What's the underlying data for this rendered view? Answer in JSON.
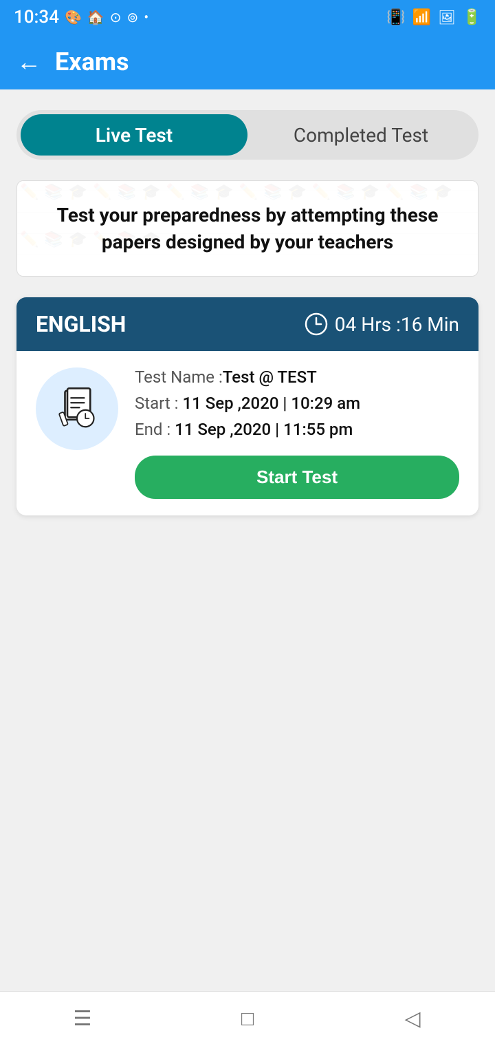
{
  "statusBar": {
    "time": "10:34",
    "icons": [
      "🎨",
      "🏠",
      "⊙",
      "⊚",
      "•"
    ]
  },
  "topBar": {
    "title": "Exams",
    "backLabel": "←"
  },
  "tabs": {
    "active": "Live Test",
    "inactive": "Completed Test"
  },
  "banner": {
    "text": "Test your preparedness by attempting these papers designed by your teachers"
  },
  "examCard": {
    "subject": "ENGLISH",
    "timer": "04 Hrs :16 Min",
    "testNameLabel": "Test Name :",
    "testNameValue": "Test @ TEST",
    "startLabel": "Start :",
    "startValue": "11 Sep ,2020 | 10:29 am",
    "endLabel": "End :",
    "endValue": "11 Sep ,2020 | 11:55 pm",
    "startButtonLabel": "Start Test"
  },
  "bottomNav": {
    "menuIcon": "☰",
    "homeIcon": "□",
    "backIcon": "◁"
  }
}
